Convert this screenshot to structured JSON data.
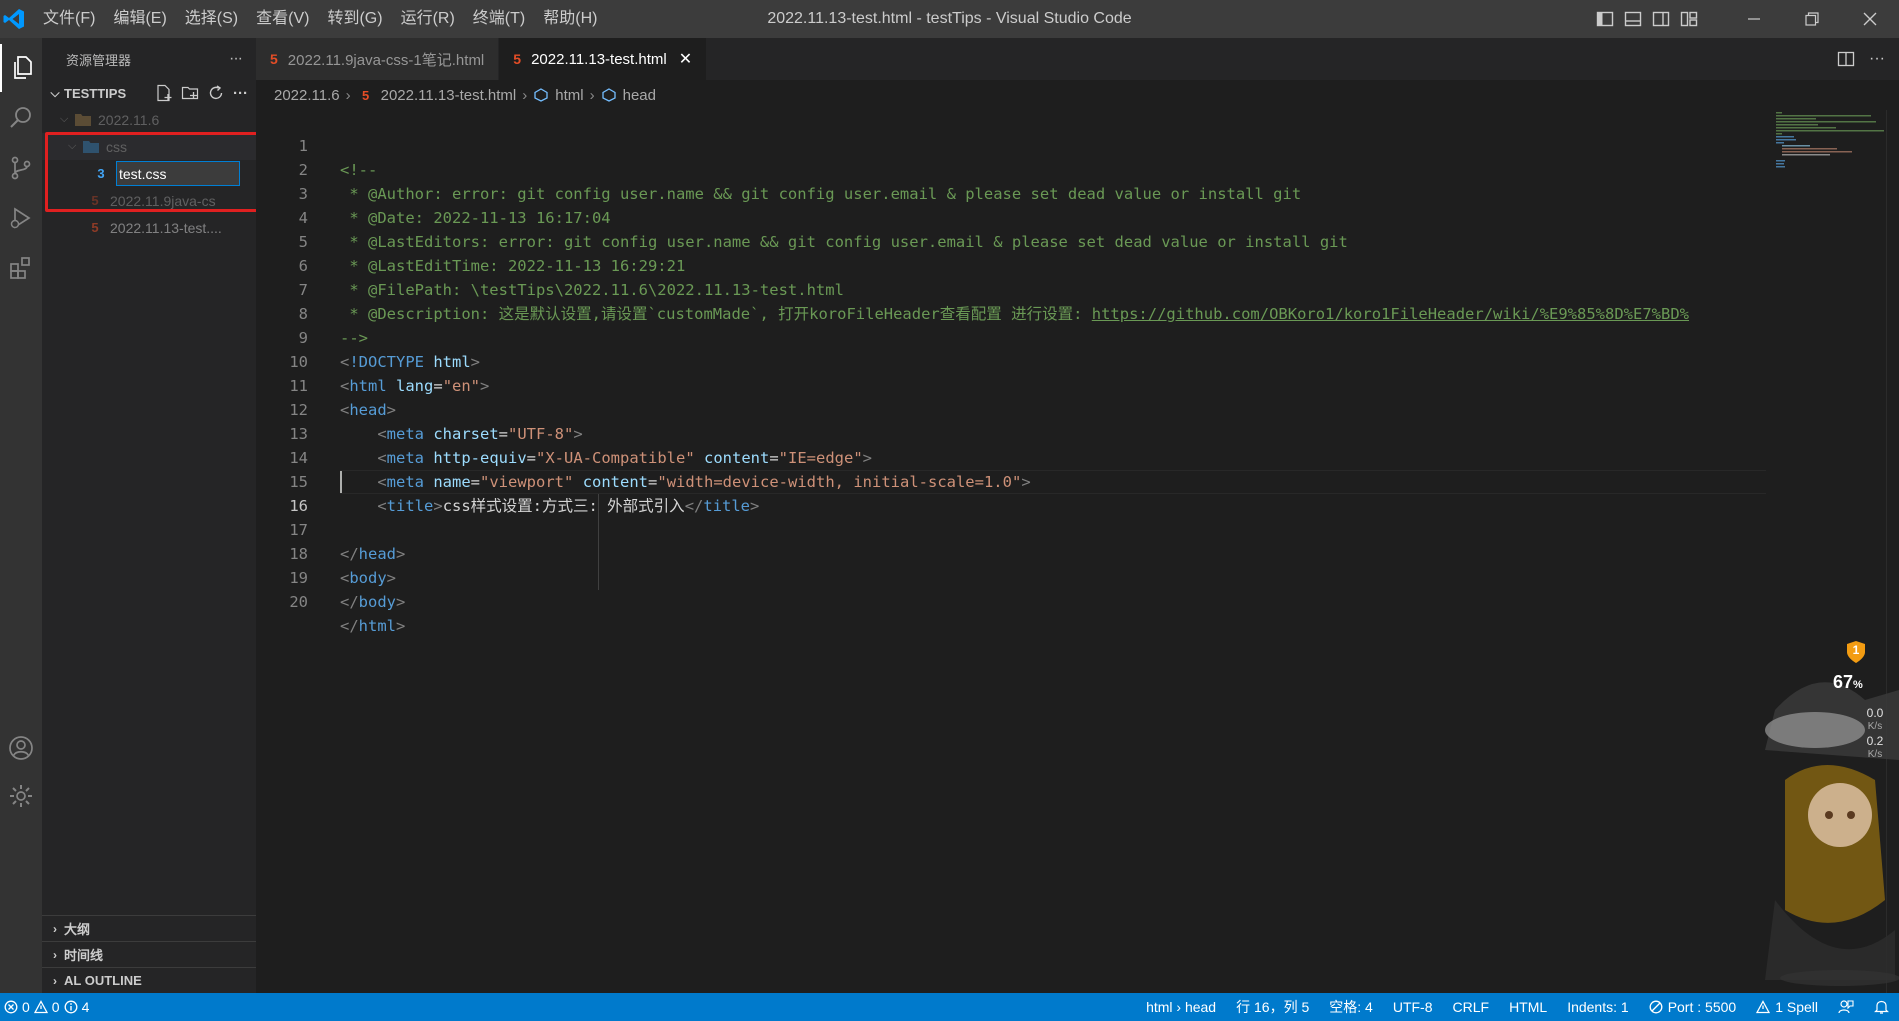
{
  "window": {
    "title": "2022.11.13-test.html - testTips - Visual Studio Code",
    "menu": [
      "文件(F)",
      "编辑(E)",
      "选择(S)",
      "查看(V)",
      "转到(G)",
      "运行(R)",
      "终端(T)",
      "帮助(H)"
    ]
  },
  "sidebar": {
    "title": "资源管理器",
    "more": "···",
    "section": "TESTTIPS",
    "tree": [
      {
        "label": "2022.11.6",
        "type": "folder",
        "depth": 1
      },
      {
        "label": "css",
        "type": "folder",
        "depth": 2
      },
      {
        "label": "2022.11.9java-cs",
        "type": "html",
        "depth": 2
      },
      {
        "label": "2022.11.13-test....",
        "type": "html",
        "depth": 2
      }
    ],
    "rename_value": "test.css",
    "bottom_sections": [
      "大纲",
      "时间线",
      "AL OUTLINE"
    ]
  },
  "tabs": [
    {
      "label": "2022.11.9java-css-1笔记.html",
      "active": false
    },
    {
      "label": "2022.11.13-test.html",
      "active": true,
      "close": "✕"
    }
  ],
  "breadcrumb": {
    "folder": "2022.11.6",
    "file": "2022.11.13-test.html",
    "node1": "html",
    "node2": "head"
  },
  "editor": {
    "current_line": 16,
    "line_numbers": [
      "1",
      "2",
      "3",
      "4",
      "5",
      "6",
      "7",
      "8",
      "9",
      "10",
      "11",
      "12",
      "13",
      "14",
      "15",
      "16",
      "17",
      "18",
      "19",
      "20"
    ],
    "lines": {
      "l1": "<!--",
      "l2": " * @Author: error: git config user.name && git config user.email & please set dead value or install git",
      "l3": " * @Date: 2022-11-13 16:17:04",
      "l4": " * @LastEditors: error: git config user.name && git config user.email & please set dead value or install git",
      "l5": " * @LastEditTime: 2022-11-13 16:29:21",
      "l6": " * @FilePath: \\testTips\\2022.11.6\\2022.11.13-test.html",
      "l7_text": " * @Description: 这是默认设置,请设置`customMade`, 打开koroFileHeader查看配置 进行设置: ",
      "l7_link": "https://github.com/OBKoro1/koro1FileHeader/wiki/%E9%85%8D%E7%BD%",
      "l8": "-->",
      "doctype_kw": "!DOCTYPE",
      "doctype_val": "html",
      "html_tag": "html",
      "lang_attr": "lang",
      "lang_val": "\"en\"",
      "head_tag": "head",
      "meta_tag": "meta",
      "charset_attr": "charset",
      "charset_val": "\"UTF-8\"",
      "httpequiv_attr": "http-equiv",
      "httpequiv_val": "\"X-UA-Compatible\"",
      "content_attr": "content",
      "content_val1": "\"IE=edge\"",
      "name_attr": "name",
      "name_val": "\"viewport\"",
      "content_val2": "\"width=device-width, initial-scale=1.0\"",
      "title_tag": "title",
      "title_text": "css样式设置:方式三: 外部式引入",
      "body_tag": "body"
    }
  },
  "widget": {
    "badge": "1",
    "cpu_percent": "67",
    "percent_sign": "%",
    "up_value": "0.0",
    "up_unit": "K/s",
    "down_value": "0.2",
    "down_unit": "K/s"
  },
  "statusbar": {
    "errors": "0",
    "warnings": "0",
    "infos": "4",
    "breadcrumb": "html › head",
    "position": "行 16，列 5",
    "spaces": "空格: 4",
    "encoding": "UTF-8",
    "eol": "CRLF",
    "language": "HTML",
    "indents": "Indents: 1",
    "port": "Port : 5500",
    "spell": "1 Spell"
  },
  "colors": {
    "accent": "#007acc",
    "html_icon": "#e44d26",
    "css_icon": "#42a5f5",
    "annotation_box": "#e02020"
  }
}
